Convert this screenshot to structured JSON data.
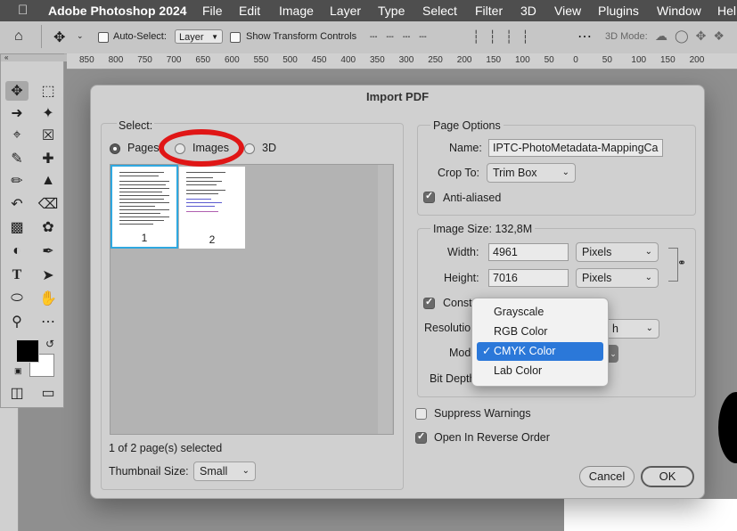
{
  "menubar": {
    "apple": "",
    "app": "Adobe Photoshop 2024",
    "items": [
      "File",
      "Edit",
      "Image",
      "Layer",
      "Type",
      "Select",
      "Filter",
      "3D",
      "View",
      "Plugins",
      "Window",
      "Hel"
    ]
  },
  "optionsbar": {
    "auto_select_label": "Auto-Select:",
    "auto_select_value": "Layer",
    "transform_label": "Show Transform Controls",
    "mode3d_label": "3D Mode:"
  },
  "ruler": {
    "ticks": [
      "850",
      "800",
      "750",
      "700",
      "650",
      "600",
      "550",
      "500",
      "450",
      "400",
      "350",
      "300",
      "250",
      "200",
      "150",
      "100",
      "50",
      "0",
      "50",
      "100",
      "150",
      "200"
    ]
  },
  "dialog": {
    "title": "Import PDF",
    "select": {
      "label": "Select:",
      "options": {
        "pages": "Pages",
        "images": "Images",
        "three_d": "3D"
      },
      "selected": "Pages",
      "thumbnails": [
        "1",
        "2"
      ],
      "status": "1 of 2 page(s) selected",
      "thumb_size_label": "Thumbnail Size:",
      "thumb_size_value": "Small"
    },
    "page_options": {
      "title": "Page Options",
      "name_label": "Name:",
      "name_value": "IPTC-PhotoMetadata-MappingCa",
      "crop_label": "Crop To:",
      "crop_value": "Trim Box",
      "anti_aliased": "Anti-aliased"
    },
    "image_size": {
      "title": "Image Size: 132,8M",
      "width_label": "Width:",
      "width_value": "4961",
      "width_unit": "Pixels",
      "height_label": "Height:",
      "height_value": "7016",
      "height_unit": "Pixels",
      "constrain_label": "Const",
      "resolution_label": "Resolution",
      "resolution_tail": "h",
      "mode_label": "Mode",
      "bit_depth_label": "Bit Depth"
    },
    "suppress_warnings": "Suppress Warnings",
    "reverse_order": "Open In Reverse Order",
    "cancel": "Cancel",
    "ok": "OK"
  },
  "mode_menu": {
    "items": [
      "Grayscale",
      "RGB Color",
      "CMYK Color",
      "Lab Color"
    ],
    "selected": "CMYK Color",
    "check": "✓"
  },
  "colors": {
    "highlight": "#2b78d9",
    "annotation": "#e01616",
    "thumb_selected": "#2fa8e0"
  }
}
